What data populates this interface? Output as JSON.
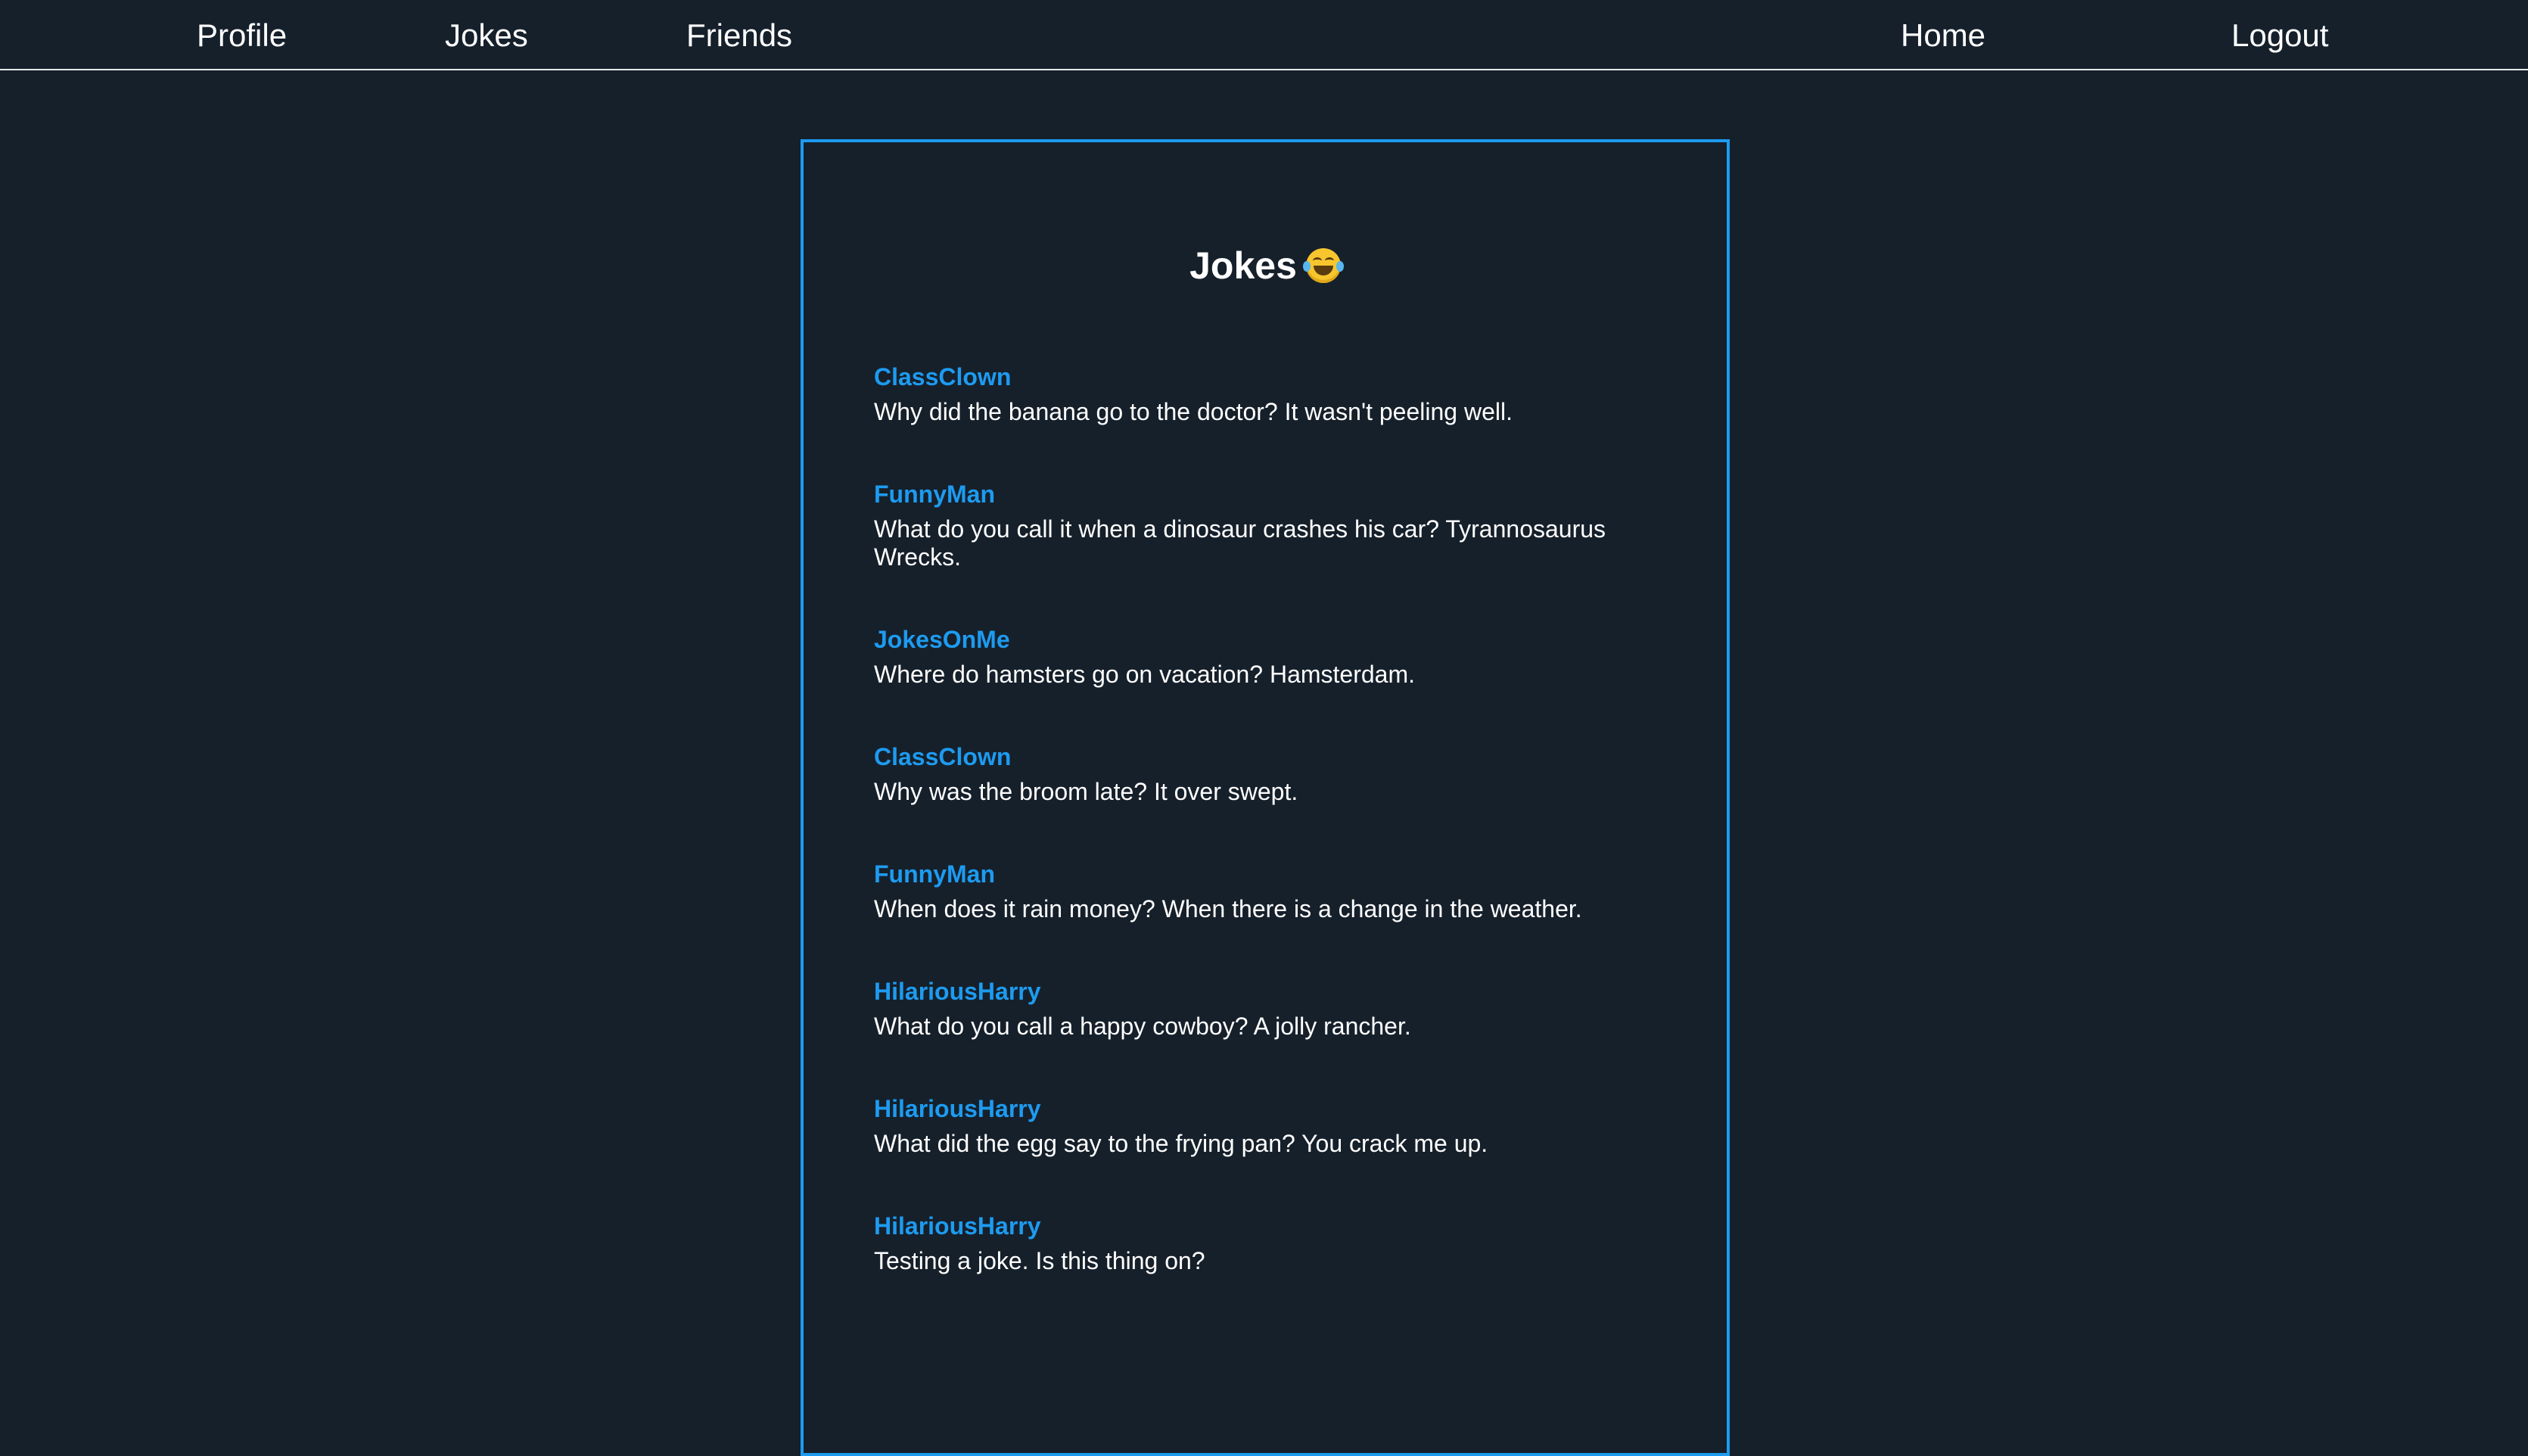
{
  "nav": {
    "profile": "Profile",
    "jokes": "Jokes",
    "friends": "Friends",
    "home": "Home",
    "logout": "Logout"
  },
  "page": {
    "title": "Jokes",
    "title_icon": "face-with-tears-of-joy-icon"
  },
  "jokes": [
    {
      "author": "ClassClown",
      "text": "Why did the banana go to the doctor? It wasn't peeling well."
    },
    {
      "author": "FunnyMan",
      "text": "What do you call it when a dinosaur crashes his car? Tyrannosaurus Wrecks."
    },
    {
      "author": "JokesOnMe",
      "text": "Where do hamsters go on vacation? Hamsterdam."
    },
    {
      "author": "ClassClown",
      "text": "Why was the broom late? It over swept."
    },
    {
      "author": "FunnyMan",
      "text": "When does it rain money? When there is a change in the weather."
    },
    {
      "author": "HilariousHarry",
      "text": "What do you call a happy cowboy? A jolly rancher."
    },
    {
      "author": "HilariousHarry",
      "text": "What did the egg say to the frying pan? You crack me up."
    },
    {
      "author": "HilariousHarry",
      "text": "Testing a joke. Is this thing on?"
    }
  ],
  "colors": {
    "background": "#16202b",
    "accent": "#1d9bf0",
    "text": "#ffffff",
    "nav_border": "#e6e8eb"
  }
}
